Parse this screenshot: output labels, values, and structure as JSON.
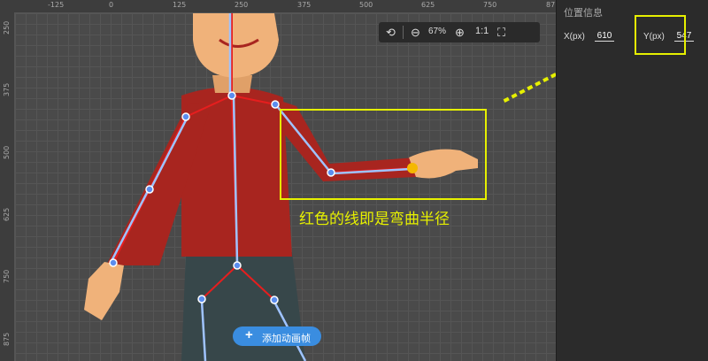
{
  "ruler": {
    "top_ticks": [
      "-125",
      "0",
      "125",
      "250",
      "375",
      "500",
      "625",
      "750",
      "87"
    ],
    "left_ticks": [
      "250",
      "375",
      "500",
      "625",
      "750",
      "875"
    ]
  },
  "toolbar": {
    "undo_icon": "undo-icon",
    "zoom_out_icon": "zoom-out-icon",
    "zoom_level": "67%",
    "zoom_in_icon": "zoom-in-icon",
    "actual_size_label": "1:1",
    "fullscreen_icon": "fullscreen-icon"
  },
  "panel": {
    "title": "位置信息",
    "x_label": "X(px)",
    "x_value": "610",
    "y_label": "Y(px)",
    "y_value": "547"
  },
  "annotation": {
    "text": "红色的线即是弯曲半径",
    "color": "#e6f000"
  },
  "add_button": {
    "icon": "plus-icon",
    "label": "添加动画帧"
  },
  "colors": {
    "bone": "#e61e1e",
    "joint": "#5b8def",
    "selected_joint": "#f5b800",
    "shirt": "#a8251f",
    "skin": "#f0b27a",
    "accent": "#3a8de0"
  }
}
